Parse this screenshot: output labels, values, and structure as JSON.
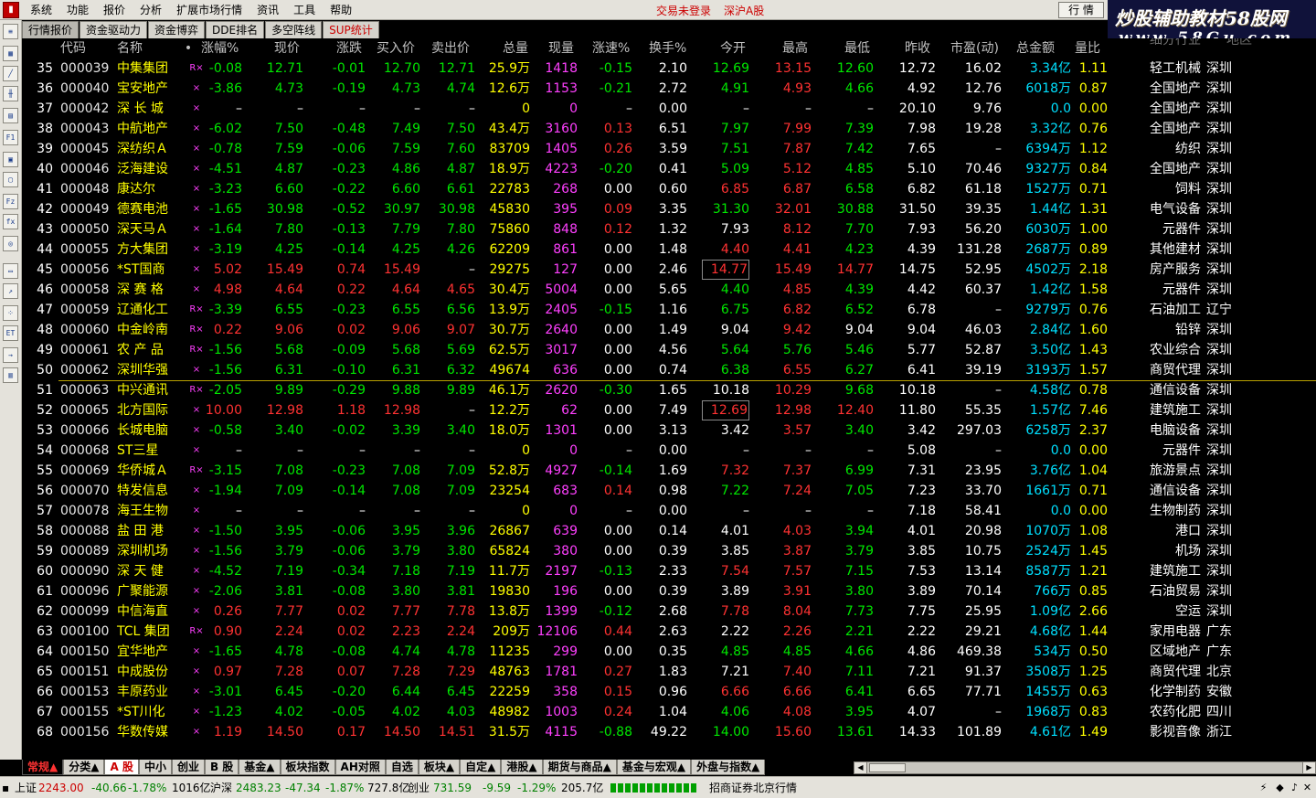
{
  "menu": {
    "items": [
      "系统",
      "功能",
      "报价",
      "分析",
      "扩展市场行情",
      "资讯",
      "工具",
      "帮助"
    ],
    "login_status": "交易未登录",
    "market": "深沪A股",
    "view_button": "行 情"
  },
  "watermark": {
    "line1": "炒股辅助教材58股网",
    "line2": "www.58Gu.com"
  },
  "top_tabs": [
    "行情报价",
    "资金驱动力",
    "资金博弈",
    "DDE排名",
    "多空阵线",
    "SUP统计"
  ],
  "columns": [
    "代码",
    "名称",
    "•",
    "涨幅%",
    "现价",
    "涨跌",
    "买入价",
    "卖出价",
    "总量",
    "现量",
    "涨速%",
    "换手%",
    "今开",
    "最高",
    "最低",
    "昨收",
    "市盈(动)",
    "总金额",
    "量比",
    "细分行业",
    "地区"
  ],
  "rows": [
    [
      "35",
      "000039",
      "中集集团",
      "R×",
      "-0.08",
      "12.71",
      "-0.01",
      "12.70",
      "12.71",
      "25.9万",
      "1418",
      "-0.15",
      "2.10",
      "12.69",
      "13.15",
      "12.60",
      "12.72",
      "16.02",
      "3.34亿",
      "1.11",
      "轻工机械",
      "深圳"
    ],
    [
      "36",
      "000040",
      "宝安地产",
      "×",
      "-3.86",
      "4.73",
      "-0.19",
      "4.73",
      "4.74",
      "12.6万",
      "1153",
      "-0.21",
      "2.72",
      "4.91",
      "4.93",
      "4.66",
      "4.92",
      "12.76",
      "6018万",
      "0.87",
      "全国地产",
      "深圳"
    ],
    [
      "37",
      "000042",
      "深 长 城",
      "×",
      "–",
      "–",
      "–",
      "–",
      "–",
      "0",
      "0",
      "–",
      "0.00",
      "–",
      "–",
      "–",
      "20.10",
      "9.76",
      "0.0",
      "0.00",
      "全国地产",
      "深圳"
    ],
    [
      "38",
      "000043",
      "中航地产",
      "×",
      "-6.02",
      "7.50",
      "-0.48",
      "7.49",
      "7.50",
      "43.4万",
      "3160",
      "0.13",
      "6.51",
      "7.97",
      "7.99",
      "7.39",
      "7.98",
      "19.28",
      "3.32亿",
      "0.76",
      "全国地产",
      "深圳"
    ],
    [
      "39",
      "000045",
      "深纺织Ａ",
      "×",
      "-0.78",
      "7.59",
      "-0.06",
      "7.59",
      "7.60",
      "83709",
      "1405",
      "0.26",
      "3.59",
      "7.51",
      "7.87",
      "7.42",
      "7.65",
      "–",
      "6394万",
      "1.12",
      "纺织",
      "深圳"
    ],
    [
      "40",
      "000046",
      "泛海建设",
      "×",
      "-4.51",
      "4.87",
      "-0.23",
      "4.86",
      "4.87",
      "18.9万",
      "4223",
      "-0.20",
      "0.41",
      "5.09",
      "5.12",
      "4.85",
      "5.10",
      "70.46",
      "9327万",
      "0.84",
      "全国地产",
      "深圳"
    ],
    [
      "41",
      "000048",
      "康达尔",
      "×",
      "-3.23",
      "6.60",
      "-0.22",
      "6.60",
      "6.61",
      "22783",
      "268",
      "0.00",
      "0.60",
      "6.85",
      "6.87",
      "6.58",
      "6.82",
      "61.18",
      "1527万",
      "0.71",
      "饲料",
      "深圳"
    ],
    [
      "42",
      "000049",
      "德赛电池",
      "×",
      "-1.65",
      "30.98",
      "-0.52",
      "30.97",
      "30.98",
      "45830",
      "395",
      "0.09",
      "3.35",
      "31.30",
      "32.01",
      "30.88",
      "31.50",
      "39.35",
      "1.44亿",
      "1.31",
      "电气设备",
      "深圳"
    ],
    [
      "43",
      "000050",
      "深天马Ａ",
      "×",
      "-1.64",
      "7.80",
      "-0.13",
      "7.79",
      "7.80",
      "75860",
      "848",
      "0.12",
      "1.32",
      "7.93",
      "8.12",
      "7.70",
      "7.93",
      "56.20",
      "6030万",
      "1.00",
      "元器件",
      "深圳"
    ],
    [
      "44",
      "000055",
      "方大集团",
      "×",
      "-3.19",
      "4.25",
      "-0.14",
      "4.25",
      "4.26",
      "62209",
      "861",
      "0.00",
      "1.48",
      "4.40",
      "4.41",
      "4.23",
      "4.39",
      "131.28",
      "2687万",
      "0.89",
      "其他建材",
      "深圳"
    ],
    [
      "45",
      "000056",
      "*ST国商",
      "×",
      "5.02",
      "15.49",
      "0.74",
      "15.49",
      "–",
      "29275",
      "127",
      "0.00",
      "2.46",
      "14.77",
      "15.49",
      "14.77",
      "14.75",
      "52.95",
      "4502万",
      "2.18",
      "房产服务",
      "深圳"
    ],
    [
      "46",
      "000058",
      "深 赛 格",
      "×",
      "4.98",
      "4.64",
      "0.22",
      "4.64",
      "4.65",
      "30.4万",
      "5004",
      "0.00",
      "5.65",
      "4.40",
      "4.85",
      "4.39",
      "4.42",
      "60.37",
      "1.42亿",
      "1.58",
      "元器件",
      "深圳"
    ],
    [
      "47",
      "000059",
      "辽通化工",
      "R×",
      "-3.39",
      "6.55",
      "-0.23",
      "6.55",
      "6.56",
      "13.9万",
      "2405",
      "-0.15",
      "1.16",
      "6.75",
      "6.82",
      "6.52",
      "6.78",
      "–",
      "9279万",
      "0.76",
      "石油加工",
      "辽宁"
    ],
    [
      "48",
      "000060",
      "中金岭南",
      "R×",
      "0.22",
      "9.06",
      "0.02",
      "9.06",
      "9.07",
      "30.7万",
      "2640",
      "0.00",
      "1.49",
      "9.04",
      "9.42",
      "9.04",
      "9.04",
      "46.03",
      "2.84亿",
      "1.60",
      "铅锌",
      "深圳"
    ],
    [
      "49",
      "000061",
      "农 产 品",
      "R×",
      "-1.56",
      "5.68",
      "-0.09",
      "5.68",
      "5.69",
      "62.5万",
      "3017",
      "0.00",
      "4.56",
      "5.64",
      "5.76",
      "5.46",
      "5.77",
      "52.87",
      "3.50亿",
      "1.43",
      "农业综合",
      "深圳"
    ],
    [
      "50",
      "000062",
      "深圳华强",
      "×",
      "-1.56",
      "6.31",
      "-0.10",
      "6.31",
      "6.32",
      "49674",
      "636",
      "0.00",
      "0.74",
      "6.38",
      "6.55",
      "6.27",
      "6.41",
      "39.19",
      "3193万",
      "1.57",
      "商贸代理",
      "深圳"
    ],
    [
      "51",
      "000063",
      "中兴通讯",
      "R×",
      "-2.05",
      "9.89",
      "-0.29",
      "9.88",
      "9.89",
      "46.1万",
      "2620",
      "-0.30",
      "1.65",
      "10.18",
      "10.29",
      "9.68",
      "10.18",
      "–",
      "4.58亿",
      "0.78",
      "通信设备",
      "深圳"
    ],
    [
      "52",
      "000065",
      "北方国际",
      "×",
      "10.00",
      "12.98",
      "1.18",
      "12.98",
      "–",
      "12.2万",
      "62",
      "0.00",
      "7.49",
      "12.69",
      "12.98",
      "12.40",
      "11.80",
      "55.35",
      "1.57亿",
      "7.46",
      "建筑施工",
      "深圳"
    ],
    [
      "53",
      "000066",
      "长城电脑",
      "×",
      "-0.58",
      "3.40",
      "-0.02",
      "3.39",
      "3.40",
      "18.0万",
      "1301",
      "0.00",
      "3.13",
      "3.42",
      "3.57",
      "3.40",
      "3.42",
      "297.03",
      "6258万",
      "2.37",
      "电脑设备",
      "深圳"
    ],
    [
      "54",
      "000068",
      "ST三星",
      "×",
      "–",
      "–",
      "–",
      "–",
      "–",
      "0",
      "0",
      "–",
      "0.00",
      "–",
      "–",
      "–",
      "5.08",
      "–",
      "0.0",
      "0.00",
      "元器件",
      "深圳"
    ],
    [
      "55",
      "000069",
      "华侨城Ａ",
      "R×",
      "-3.15",
      "7.08",
      "-0.23",
      "7.08",
      "7.09",
      "52.8万",
      "4927",
      "-0.14",
      "1.69",
      "7.32",
      "7.37",
      "6.99",
      "7.31",
      "23.95",
      "3.76亿",
      "1.04",
      "旅游景点",
      "深圳"
    ],
    [
      "56",
      "000070",
      "特发信息",
      "×",
      "-1.94",
      "7.09",
      "-0.14",
      "7.08",
      "7.09",
      "23254",
      "683",
      "0.14",
      "0.98",
      "7.22",
      "7.24",
      "7.05",
      "7.23",
      "33.70",
      "1661万",
      "0.71",
      "通信设备",
      "深圳"
    ],
    [
      "57",
      "000078",
      "海王生物",
      "×",
      "–",
      "–",
      "–",
      "–",
      "–",
      "0",
      "0",
      "–",
      "0.00",
      "–",
      "–",
      "–",
      "7.18",
      "58.41",
      "0.0",
      "0.00",
      "生物制药",
      "深圳"
    ],
    [
      "58",
      "000088",
      "盐 田 港",
      "×",
      "-1.50",
      "3.95",
      "-0.06",
      "3.95",
      "3.96",
      "26867",
      "639",
      "0.00",
      "0.14",
      "4.01",
      "4.03",
      "3.94",
      "4.01",
      "20.98",
      "1070万",
      "1.08",
      "港口",
      "深圳"
    ],
    [
      "59",
      "000089",
      "深圳机场",
      "×",
      "-1.56",
      "3.79",
      "-0.06",
      "3.79",
      "3.80",
      "65824",
      "380",
      "0.00",
      "0.39",
      "3.85",
      "3.87",
      "3.79",
      "3.85",
      "10.75",
      "2524万",
      "1.45",
      "机场",
      "深圳"
    ],
    [
      "60",
      "000090",
      "深 天 健",
      "×",
      "-4.52",
      "7.19",
      "-0.34",
      "7.18",
      "7.19",
      "11.7万",
      "2197",
      "-0.13",
      "2.33",
      "7.54",
      "7.57",
      "7.15",
      "7.53",
      "13.14",
      "8587万",
      "1.21",
      "建筑施工",
      "深圳"
    ],
    [
      "61",
      "000096",
      "广聚能源",
      "×",
      "-2.06",
      "3.81",
      "-0.08",
      "3.80",
      "3.81",
      "19830",
      "196",
      "0.00",
      "0.39",
      "3.89",
      "3.91",
      "3.80",
      "3.89",
      "70.14",
      "766万",
      "0.85",
      "石油贸易",
      "深圳"
    ],
    [
      "62",
      "000099",
      "中信海直",
      "×",
      "0.26",
      "7.77",
      "0.02",
      "7.77",
      "7.78",
      "13.8万",
      "1399",
      "-0.12",
      "2.68",
      "7.78",
      "8.04",
      "7.73",
      "7.75",
      "25.95",
      "1.09亿",
      "2.66",
      "空运",
      "深圳"
    ],
    [
      "63",
      "000100",
      "TCL 集团",
      "R×",
      "0.90",
      "2.24",
      "0.02",
      "2.23",
      "2.24",
      "209万",
      "12106",
      "0.44",
      "2.63",
      "2.22",
      "2.26",
      "2.21",
      "2.22",
      "29.21",
      "4.68亿",
      "1.44",
      "家用电器",
      "广东"
    ],
    [
      "64",
      "000150",
      "宜华地产",
      "×",
      "-1.65",
      "4.78",
      "-0.08",
      "4.74",
      "4.78",
      "11235",
      "299",
      "0.00",
      "0.35",
      "4.85",
      "4.85",
      "4.66",
      "4.86",
      "469.38",
      "534万",
      "0.50",
      "区域地产",
      "广东"
    ],
    [
      "65",
      "000151",
      "中成股份",
      "×",
      "0.97",
      "7.28",
      "0.07",
      "7.28",
      "7.29",
      "48763",
      "1781",
      "0.27",
      "1.83",
      "7.21",
      "7.40",
      "7.11",
      "7.21",
      "91.37",
      "3508万",
      "1.25",
      "商贸代理",
      "北京"
    ],
    [
      "66",
      "000153",
      "丰原药业",
      "×",
      "-3.01",
      "6.45",
      "-0.20",
      "6.44",
      "6.45",
      "22259",
      "358",
      "0.15",
      "0.96",
      "6.66",
      "6.66",
      "6.41",
      "6.65",
      "77.71",
      "1455万",
      "0.63",
      "化学制药",
      "安徽"
    ],
    [
      "67",
      "000155",
      "*ST川化",
      "×",
      "-1.23",
      "4.02",
      "-0.05",
      "4.02",
      "4.03",
      "48982",
      "1003",
      "0.24",
      "1.04",
      "4.06",
      "4.08",
      "3.95",
      "4.07",
      "–",
      "1968万",
      "0.83",
      "农药化肥",
      "四川"
    ],
    [
      "68",
      "000156",
      "华数传媒",
      "×",
      "1.19",
      "14.50",
      "0.17",
      "14.50",
      "14.51",
      "31.5万",
      "4115",
      "-0.88",
      "49.22",
      "14.00",
      "15.60",
      "13.61",
      "14.33",
      "101.89",
      "4.61亿",
      "1.49",
      "影视音像",
      "浙江"
    ]
  ],
  "boxed": [
    "45:13",
    "52:13"
  ],
  "bottom_tabs": [
    "常规▲",
    "分类▲",
    "A 股",
    "中小",
    "创业",
    "B 股",
    "基金▲",
    "板块指数",
    "AH对照",
    "自选",
    "板块▲",
    "自定▲",
    "港股▲",
    "期货与商品▲",
    "基金与宏观▲",
    "外盘与指数▲"
  ],
  "status": {
    "sh_label": "上证",
    "sh_value": "2243.00",
    "sh_change": "-40.66",
    "sh_pct": "-1.78%",
    "sh_amount": "1016亿",
    "sz_label": "沪深",
    "sz_value": "2483.23",
    "sz_change": "-47.34",
    "sz_pct": "-1.87%",
    "sz_amount": "727.8亿",
    "cy_label": "创业",
    "cy_value": "731.59",
    "cy_change": "-9.59",
    "cy_pct": "-1.29%",
    "cy_amount": "205.7亿",
    "broker": "招商证券北京行情"
  },
  "colors": {
    "up": "#ff3232",
    "down": "#00e600",
    "flat": "#ffffff",
    "code": "#e6e6e6",
    "name": "#ffff00",
    "volume": "#ffff00",
    "curvol": "#ff40ff",
    "amount": "#00e0ff",
    "industry": "#ffffff"
  }
}
